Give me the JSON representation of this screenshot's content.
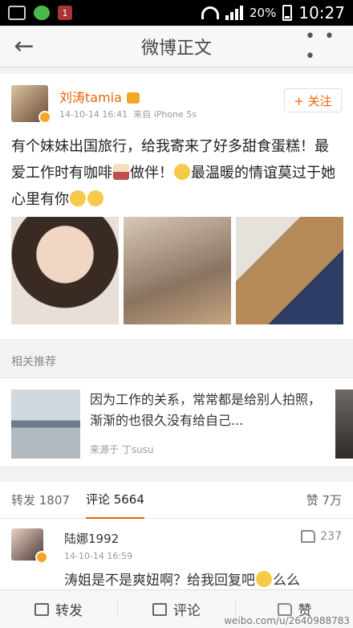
{
  "status_bar": {
    "notif_badge": "1",
    "battery": "20%",
    "time": "10:27"
  },
  "header": {
    "back_icon": "←",
    "title": "微博正文",
    "more_icon": "• • •"
  },
  "post": {
    "username": "刘涛tamia",
    "timestamp": "14-10-14 16:41",
    "source": "来自 iPhone 5s",
    "follow_label": "+ 关注",
    "text_parts": [
      "有个妹妹出国旅行，给我寄来了好多甜食蛋糕！最爱工作时有咖啡",
      "做伴！",
      "最温暖的情谊莫过于她心里有你",
      ""
    ]
  },
  "related": {
    "section_label": "相关推荐",
    "text": "因为工作的关系，常常都是给别人拍照，渐渐的也很久没有给自己...",
    "source": "来源于 丁susu"
  },
  "tabs": {
    "repost": "转发 1807",
    "comment": "评论 5664",
    "like": "赞 7万"
  },
  "comment": {
    "name": "陆娜1992",
    "time": "14-10-14 16:59",
    "likes": "237",
    "text": "涛姐是不是爽妞啊？给我回复吧",
    "text_tail": "么么"
  },
  "bottom_bar": {
    "repost": "转发",
    "comment": "评论",
    "like": "赞"
  },
  "watermark": "weibo.com/u/2640988783",
  "colors": {
    "accent": "#e8650a",
    "vip": "#f5a623"
  }
}
